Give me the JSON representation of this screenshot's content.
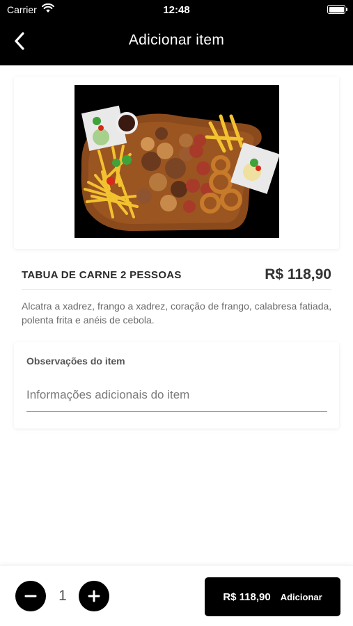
{
  "status_bar": {
    "carrier": "Carrier",
    "time": "12:48"
  },
  "nav": {
    "title": "Adicionar item",
    "back_icon": "chevron-left-icon"
  },
  "product": {
    "name": "TABUA DE CARNE 2 PESSOAS",
    "price": "R$ 118,90",
    "description": "Alcatra a xadrez, frango a xadrez, coração de frango, calabresa fatiada, polenta frita e anéis de cebola."
  },
  "notes": {
    "label": "Observações do item",
    "placeholder": "Informações adicionais do item",
    "value": ""
  },
  "footer": {
    "quantity": "1",
    "add_price": "R$ 118,90",
    "add_label": "Adicionar"
  },
  "colors": {
    "header_bg": "#000000",
    "accent": "#000000",
    "background": "#ffffff"
  }
}
